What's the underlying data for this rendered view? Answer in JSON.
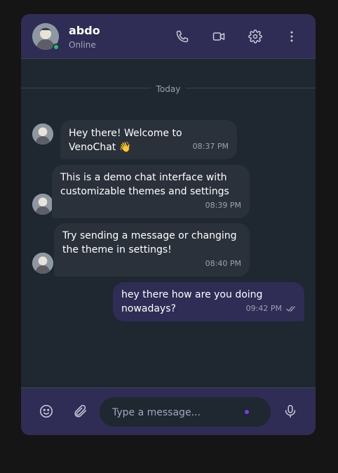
{
  "header": {
    "contact_name": "abdo",
    "contact_status": "Online",
    "icons": [
      "phone-icon",
      "video-icon",
      "gear-icon",
      "more-vertical-icon"
    ]
  },
  "day_label": "Today",
  "messages": [
    {
      "direction": "incoming",
      "text": "Hey there! Welcome to VenoChat 👋",
      "time": "08:37 PM"
    },
    {
      "direction": "incoming",
      "text": "This is a demo chat interface with customizable themes and settings",
      "time": "08:39 PM"
    },
    {
      "direction": "incoming",
      "text": "Try sending a message or changing the theme in settings!",
      "time": "08:40 PM"
    },
    {
      "direction": "outgoing",
      "text": "hey there how are you doing nowadays?",
      "time": "09:42 PM",
      "read": true
    }
  ],
  "composer": {
    "placeholder": "Type a message...",
    "icons": [
      "emoji-icon",
      "paperclip-icon",
      "microphone-icon"
    ]
  },
  "colors": {
    "accent": "#2f2c55",
    "online": "#22c55e",
    "typing_dot": "#7c3aed",
    "background": "#1f2730"
  }
}
